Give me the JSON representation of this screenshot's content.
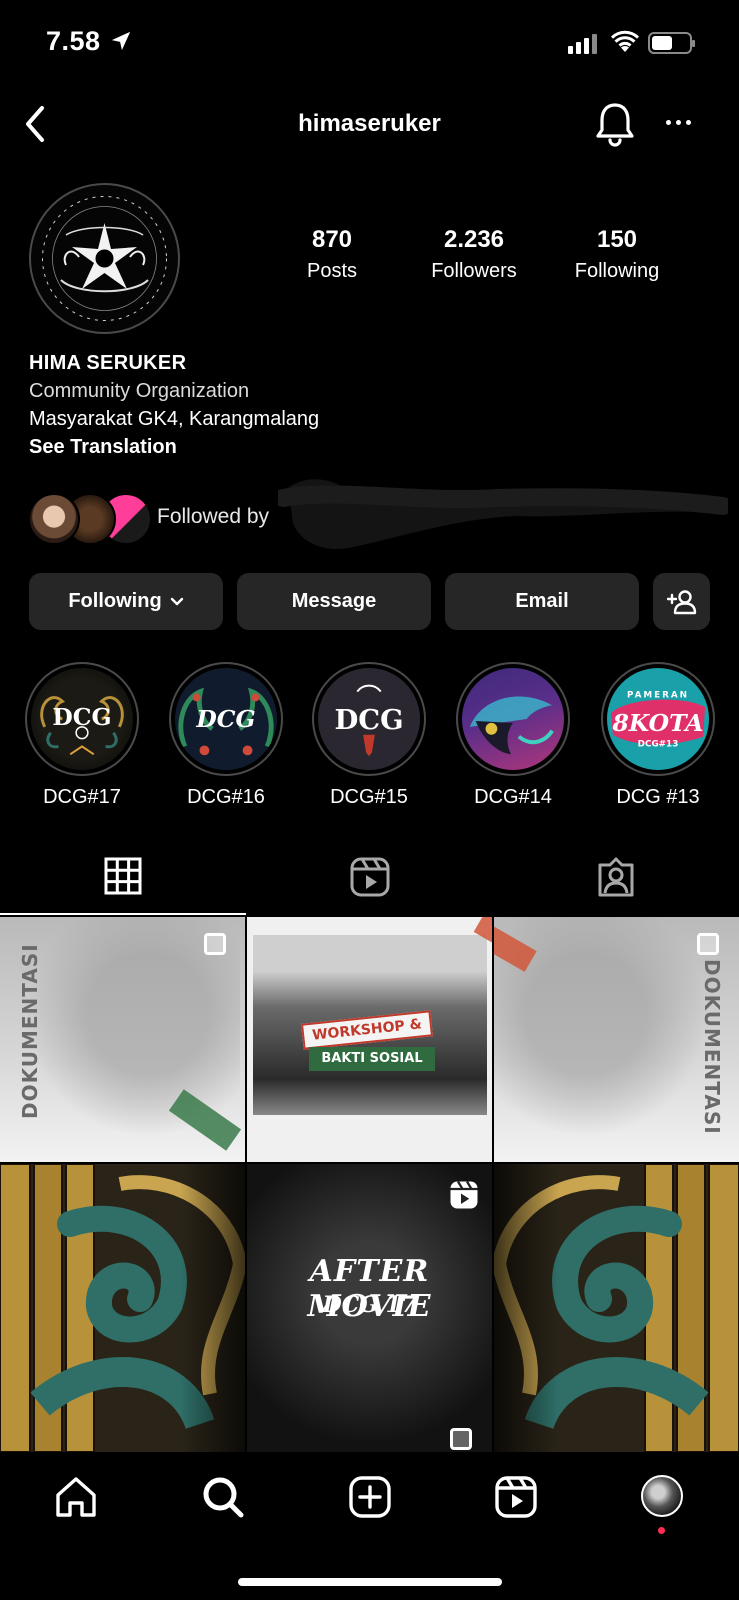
{
  "status_bar": {
    "time": "7.58"
  },
  "header": {
    "username": "himaseruker"
  },
  "profile": {
    "stats": [
      {
        "value": "870",
        "label": "Posts"
      },
      {
        "value": "2.236",
        "label": "Followers"
      },
      {
        "value": "150",
        "label": "Following"
      }
    ],
    "name": "HIMA SERUKER",
    "category": "Community Organization",
    "location": "Masyarakat GK4, Karangmalang",
    "see_translation": "See Translation",
    "followed_by": "Followed by"
  },
  "buttons": {
    "following": "Following",
    "message": "Message",
    "email": "Email"
  },
  "highlights": [
    {
      "label": "DCG#17",
      "art": "DCG"
    },
    {
      "label": "DCG#16",
      "art": "DCG"
    },
    {
      "label": "DCG#15",
      "art": "DCG"
    },
    {
      "label": "DCG#14",
      "art": ""
    },
    {
      "label": "DCG #13",
      "art": "8KOTA",
      "sub": "DCG#13",
      "top": "PAMERAN"
    }
  ],
  "grid": {
    "doc_label": "DOKUMENTASI",
    "workshop_line1": "WORKSHOP &",
    "workshop_line2": "BAKTI SOSIAL",
    "movie_line1": "AFTER MOVIE",
    "movie_line2": "DCG 17"
  },
  "colors": {
    "background": "#000000",
    "button_bg": "#262626",
    "notification_dot": "#ff2d55",
    "workshop_red": "#c0392b",
    "workshop_green": "#2f6b3e",
    "gold": "#b8923a",
    "teal": "#2f6f68"
  }
}
